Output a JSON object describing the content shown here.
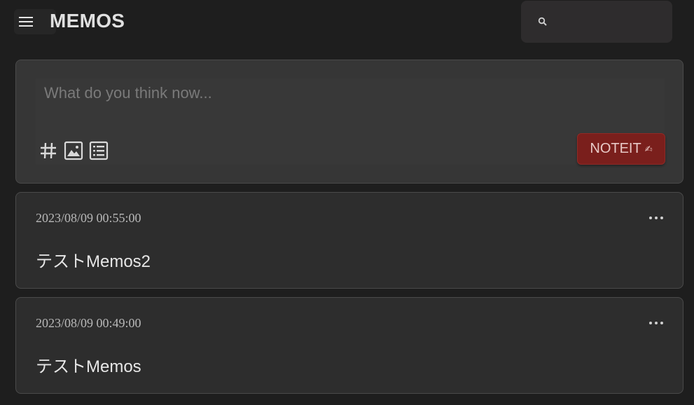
{
  "header": {
    "app_title": "MEMOS",
    "menu_icon": "hamburger-menu-icon",
    "search": {
      "icon": "magnifier-icon",
      "placeholder": "",
      "value": ""
    }
  },
  "composer": {
    "placeholder": "What do you think now...",
    "value": "",
    "tools": [
      "hashtag-icon",
      "image-icon",
      "list-icon"
    ],
    "submit_label": "NOTEIT",
    "submit_icon": "✍"
  },
  "memos": [
    {
      "timestamp": "2023/08/09 00:55:00",
      "content": "テストMemos2"
    },
    {
      "timestamp": "2023/08/09 00:49:00",
      "content": "テストMemos"
    }
  ],
  "colors": {
    "background": "#1e1e1e",
    "card": "#2d2d2d",
    "accent": "#7a1f1c"
  }
}
